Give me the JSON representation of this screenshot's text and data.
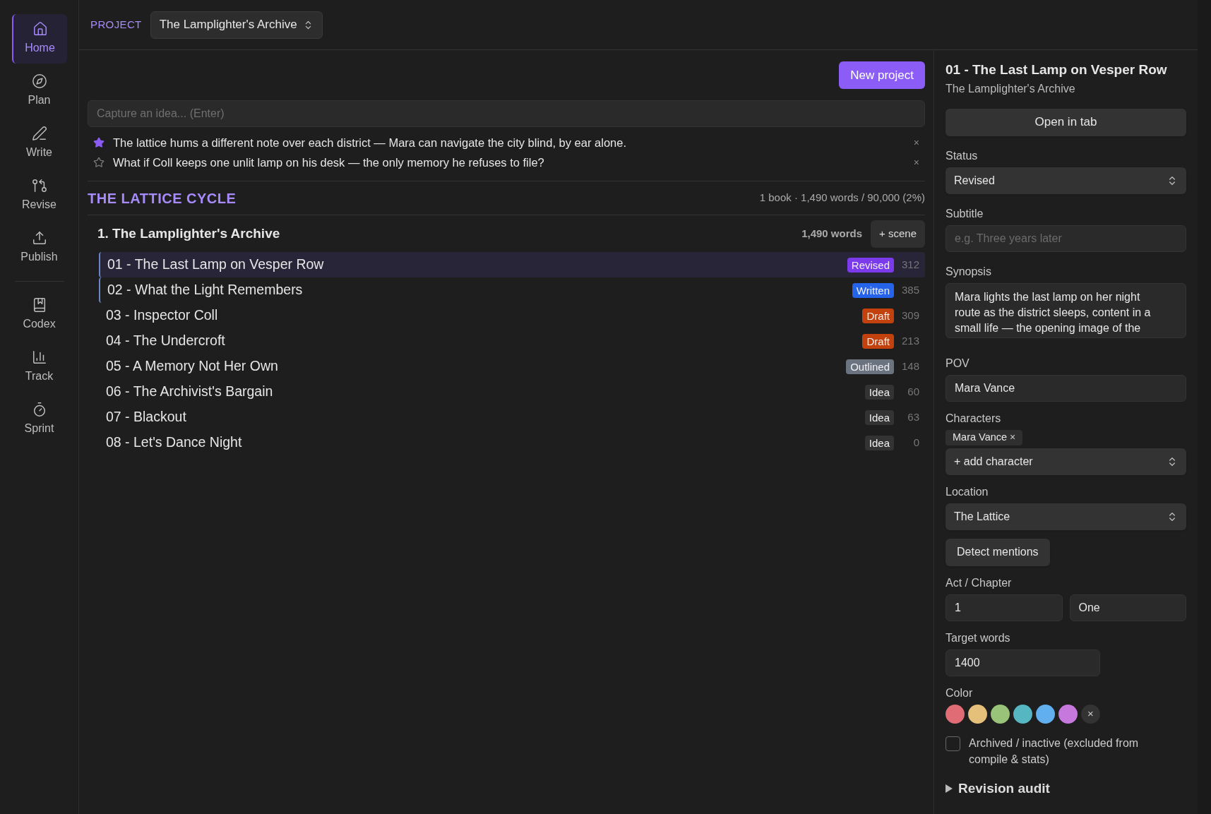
{
  "nav": [
    {
      "label": "Home",
      "selected": true
    },
    {
      "label": "Plan",
      "selected": false
    },
    {
      "label": "Write",
      "selected": false
    },
    {
      "label": "Revise",
      "selected": false
    },
    {
      "label": "Publish",
      "selected": false
    },
    {
      "label": "Codex",
      "selected": false
    },
    {
      "label": "Track",
      "selected": false
    },
    {
      "label": "Sprint",
      "selected": false
    }
  ],
  "project": {
    "label": "PROJECT",
    "value": "The Lamplighter's Archive"
  },
  "new_project": "New project",
  "idea_input": {
    "placeholder": "Capture an idea... (Enter)"
  },
  "ideas": [
    {
      "text": "The lattice hums a different note over each district — Mara can navigate the city blind, by ear alone.",
      "starred": true,
      "remove": "×"
    },
    {
      "text": "What if Coll keeps one unlit lamp on his desk — the only memory he refuses to file?",
      "starred": false,
      "remove": "×"
    }
  ],
  "series": {
    "title": "THE LATTICE CYCLE",
    "stats": "1 book · 1,490 words / 90,000 (2%)"
  },
  "book": {
    "title": "1. The Lamplighter's Archive",
    "words": "1,490 words",
    "add_scene": "+ scene"
  },
  "scenes": [
    {
      "title": "01 - The Last Lamp on Vesper Row",
      "status": "Revised",
      "color": "#7c3aed",
      "words": "312",
      "selected": true,
      "open": true
    },
    {
      "title": "02 - What the Light Remembers",
      "status": "Written",
      "color": "#2563eb",
      "words": "385",
      "selected": false,
      "open": true
    },
    {
      "title": "03 - Inspector Coll",
      "status": "Draft",
      "color": "#c2410c",
      "words": "309",
      "selected": false,
      "open": false
    },
    {
      "title": "04 - The Undercroft",
      "status": "Draft",
      "color": "#c2410c",
      "words": "213",
      "selected": false,
      "open": false
    },
    {
      "title": "05 - A Memory Not Her Own",
      "status": "Outlined",
      "color": "#6b7280",
      "words": "148",
      "selected": false,
      "open": false
    },
    {
      "title": "06 - The Archivist's Bargain",
      "status": "Idea",
      "color": "#333333",
      "words": "60",
      "selected": false,
      "open": false
    },
    {
      "title": "07 - Blackout",
      "status": "Idea",
      "color": "#333333",
      "words": "63",
      "selected": false,
      "open": false
    },
    {
      "title": "08 - Let's Dance Night",
      "status": "Idea",
      "color": "#333333",
      "words": "0",
      "selected": false,
      "open": false
    }
  ],
  "inspector": {
    "title": "01 - The Last Lamp on Vesper Row",
    "subtitle": "The Lamplighter's Archive",
    "open_in_tab": "Open in tab",
    "status": {
      "label": "Status",
      "value": "Revised"
    },
    "subtitle_field": {
      "label": "Subtitle",
      "placeholder": "e.g. Three years later"
    },
    "synopsis": {
      "label": "Synopsis",
      "value": "Mara lights the last lamp on her night route as the district sleeps, content in a small life — the opening image of the"
    },
    "pov": {
      "label": "POV",
      "value": "Mara Vance"
    },
    "characters": {
      "label": "Characters",
      "tags": [
        {
          "name": "Mara Vance",
          "remove": "×"
        }
      ],
      "add": "+ add character"
    },
    "location": {
      "label": "Location",
      "value": "The Lattice"
    },
    "detect": "Detect mentions",
    "act_chapter": {
      "label": "Act / Chapter",
      "act": "1",
      "chapter": "One"
    },
    "target": {
      "label": "Target words",
      "value": "1400"
    },
    "color": {
      "label": "Color",
      "swatches": [
        {
          "color": "#e06c75"
        },
        {
          "color": "#e5c07b"
        },
        {
          "color": "#98c379"
        },
        {
          "color": "#56b6c2"
        },
        {
          "color": "#61afef"
        },
        {
          "color": "#c678dd"
        }
      ],
      "clear": "×"
    },
    "archived": {
      "label": "Archived / inactive (excluded from compile & stats)",
      "checked": false
    },
    "revision_audit": {
      "label": "Revision audit",
      "expanded": false
    }
  }
}
